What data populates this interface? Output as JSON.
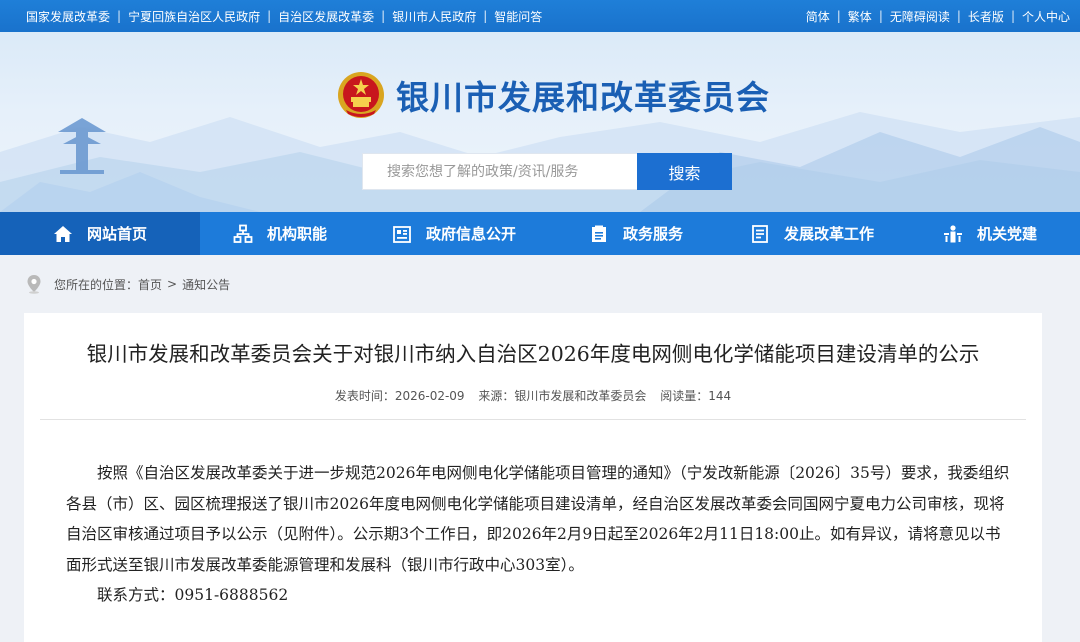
{
  "topbar": {
    "links": [
      "国家发展改革委",
      "宁夏回族自治区人民政府",
      "自治区发展改革委",
      "银川市人民政府",
      "智能问答"
    ],
    "tools": [
      "简体",
      "繁体",
      "无障碍阅读",
      "长者版",
      "个人中心"
    ]
  },
  "header": {
    "site_title": "银川市发展和改革委员会",
    "emblem_icon": "national-emblem"
  },
  "search": {
    "placeholder": "搜索您想了解的政策/资讯/服务",
    "button_label": "搜索"
  },
  "nav": {
    "items": [
      {
        "label": "网站首页",
        "icon": "home-icon",
        "active": true
      },
      {
        "label": "机构职能",
        "icon": "org-chart-icon",
        "active": false
      },
      {
        "label": "政府信息公开",
        "icon": "info-open-icon",
        "active": false
      },
      {
        "label": "政务服务",
        "icon": "service-icon",
        "active": false
      },
      {
        "label": "发展改革工作",
        "icon": "document-icon",
        "active": false
      },
      {
        "label": "机关党建",
        "icon": "party-icon",
        "active": false
      }
    ]
  },
  "breadcrumb": {
    "prefix": "您所在的位置：",
    "home": "首页",
    "separator": ">",
    "current": "通知公告"
  },
  "article": {
    "title": "银川市发展和改革委员会关于对银川市纳入自治区2026年度电网侧电化学储能项目建设清单的公示",
    "publish_time": "发表时间：2026-02-09",
    "source": "来源：银川市发展和改革委员会",
    "views": "阅读量：144",
    "body": "按照《自治区发展改革委关于进一步规范2026年电网侧电化学储能项目管理的通知》（宁发改新能源〔2026〕35号）要求，我委组织各县（市）区、园区梳理报送了银川市2026年度电网侧电化学储能项目建设清单，经自治区发展改革委会同国网宁夏电力公司审核，现将自治区审核通过项目予以公示（见附件）。公示期3个工作日，即2026年2月9日起至2026年2月11日18:00止。如有异议，请将意见以书面形式送至银川市发展改革委能源管理和发展科（银川市行政中心303室）。",
    "contact": "联系方式：0951-6888562"
  },
  "colors": {
    "topbar": "#1f7fd8",
    "nav": "#1d7bda",
    "nav_active": "#1562b9",
    "brand": "#1a5fb4",
    "search_button": "#1c6fd1"
  }
}
